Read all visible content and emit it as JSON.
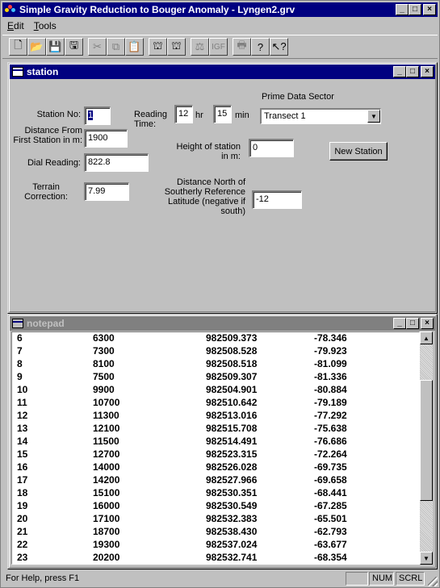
{
  "app": {
    "title": "Simple Gravity Reduction to Bouger Anomaly - Lyngen2.grv",
    "min_glyph": "_",
    "max_glyph": "□",
    "close_glyph": "×"
  },
  "menu": [
    {
      "label": "Edit",
      "accel": "E"
    },
    {
      "label": "Tools",
      "accel": "T"
    }
  ],
  "toolbar": [
    {
      "name": "new-icon",
      "glyph": "🗋",
      "enabled": true
    },
    {
      "name": "open-icon",
      "glyph": "📂",
      "enabled": true
    },
    {
      "name": "save-icon",
      "glyph": "💾",
      "enabled": true
    },
    {
      "name": "save-as-icon",
      "glyph": "🖫",
      "enabled": true
    },
    {
      "name": "cut-icon",
      "glyph": "✂",
      "enabled": false
    },
    {
      "name": "copy-icon",
      "glyph": "⧉",
      "enabled": false
    },
    {
      "name": "paste-icon",
      "glyph": "📋",
      "enabled": false
    },
    {
      "name": "station-icon",
      "glyph": "⛫",
      "enabled": true
    },
    {
      "name": "station-alt-icon",
      "glyph": "⛫",
      "enabled": true
    },
    {
      "name": "gravity-icon",
      "glyph": "⚖",
      "enabled": false
    },
    {
      "name": "igf-icon",
      "glyph": "IGF",
      "enabled": false
    },
    {
      "name": "print-icon",
      "glyph": "🖶",
      "enabled": false
    },
    {
      "name": "help-icon",
      "glyph": "?",
      "enabled": true
    },
    {
      "name": "context-help-icon",
      "glyph": "↖?",
      "enabled": true
    }
  ],
  "station": {
    "window_title": "station",
    "station_no_label": "Station No:",
    "station_no": "1",
    "distance_label": "Distance From First Station in m:",
    "distance": "1900",
    "dial_label": "Dial Reading:",
    "dial": "822.8",
    "terrain_label": "Terrain Correction:",
    "terrain": "7.99",
    "reading_time_label": "Reading Time:",
    "hour": "12",
    "hr_label": "hr",
    "minute": "15",
    "min_label": "min",
    "height_label": "Height of station in m:",
    "height": "0",
    "north_label": "Distance North of Southerly Reference Latitude (negative  if south)",
    "north": "-12",
    "sector_label": "Prime Data Sector",
    "sector": "Transect 1",
    "new_station_button": "New Station"
  },
  "notepad": {
    "window_title": "notepad",
    "rows": [
      [
        "6",
        "6300",
        "982509.373",
        "-78.346"
      ],
      [
        "7",
        "7300",
        "982508.528",
        "-79.923"
      ],
      [
        "8",
        "8100",
        "982508.518",
        "-81.099"
      ],
      [
        "9",
        "7500",
        "982509.307",
        "-81.336"
      ],
      [
        "10",
        "9900",
        "982504.901",
        "-80.884"
      ],
      [
        "11",
        "10700",
        "982510.642",
        "-79.189"
      ],
      [
        "12",
        "11300",
        "982513.016",
        "-77.292"
      ],
      [
        "13",
        "12100",
        "982515.708",
        "-75.638"
      ],
      [
        "14",
        "11500",
        "982514.491",
        "-76.686"
      ],
      [
        "15",
        "12700",
        "982523.315",
        "-72.264"
      ],
      [
        "16",
        "14000",
        "982526.028",
        "-69.735"
      ],
      [
        "17",
        "14200",
        "982527.966",
        "-69.658"
      ],
      [
        "18",
        "15100",
        "982530.351",
        "-68.441"
      ],
      [
        "19",
        "16000",
        "982530.549",
        "-67.285"
      ],
      [
        "20",
        "17100",
        "982532.383",
        "-65.501"
      ],
      [
        "21",
        "18700",
        "982538.430",
        "-62.793"
      ],
      [
        "22",
        "19300",
        "982537.024",
        "-63.677"
      ],
      [
        "23",
        "20200",
        "982532.741",
        "-68.354"
      ]
    ]
  },
  "status": {
    "text": "For Help, press F1",
    "num": "NUM",
    "scrl": "SCRL"
  }
}
